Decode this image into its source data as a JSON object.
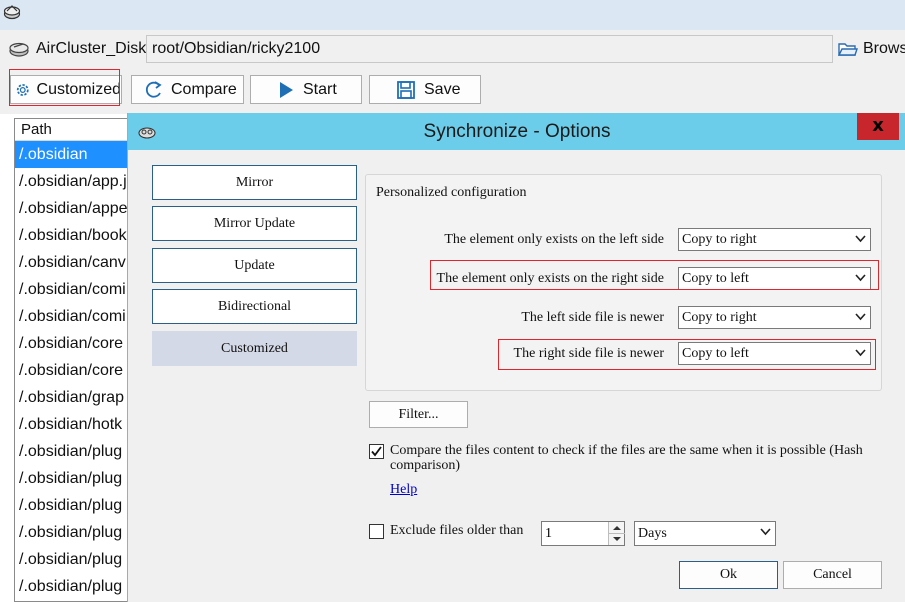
{
  "main": {
    "drive_label": "AirCluster_Disk",
    "path_value": "root/Obsidian/ricky2100",
    "browse_label": "Brows",
    "toolbar": {
      "customized_label": "Customized",
      "compare_label": "Compare",
      "start_label": "Start",
      "save_label": "Save"
    },
    "filelist": {
      "header": "Path",
      "rows": [
        "/.obsidian",
        "/.obsidian/app.j",
        "/.obsidian/appe",
        "/.obsidian/book",
        "/.obsidian/canv",
        "/.obsidian/comi",
        "/.obsidian/comi",
        "/.obsidian/core",
        "/.obsidian/core",
        "/.obsidian/grap",
        "/.obsidian/hotk",
        "/.obsidian/plug",
        "/.obsidian/plug",
        "/.obsidian/plug",
        "/.obsidian/plug",
        "/.obsidian/plug",
        "/.obsidian/plug"
      ],
      "selected_index": 0
    }
  },
  "dialog": {
    "title": "Synchronize - Options",
    "close_label": "x",
    "modes": [
      "Mirror",
      "Mirror Update",
      "Update",
      "Bidirectional",
      "Customized"
    ],
    "active_mode": "Customized",
    "group_title": "Personalized configuration",
    "rules": [
      {
        "label": "The element only exists on the left side",
        "value": "Copy to right"
      },
      {
        "label": "The element only exists on the right side",
        "value": "Copy to left"
      },
      {
        "label": "The left side file is newer",
        "value": "Copy to right"
      },
      {
        "label": "The right side file is newer",
        "value": "Copy to left"
      }
    ],
    "filter_label": "Filter...",
    "compare_content": {
      "checked": true,
      "line1": "Compare the files content to check if the files are the same when it is possible (Hash",
      "line2": "comparison)"
    },
    "help_label": "Help",
    "exclude": {
      "checked": false,
      "label": "Exclude files older than",
      "amount": "1",
      "unit": "Days"
    },
    "ok_label": "Ok",
    "cancel_label": "Cancel"
  },
  "colors": {
    "dialog_titlebar": "#6bcdea",
    "close_button": "#c7262c",
    "selection": "#1e90ff",
    "highlight_box": "#e0262d",
    "active_mode": "#d3d9e6"
  }
}
